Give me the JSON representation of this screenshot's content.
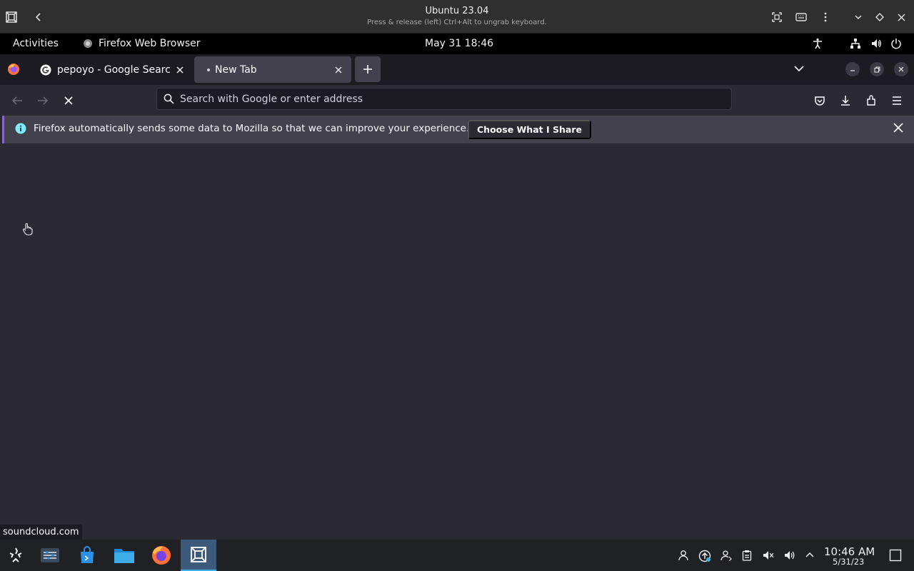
{
  "vm": {
    "title": "Ubuntu 23.04",
    "subtitle": "Press & release (left) Ctrl+Alt to ungrab keyboard."
  },
  "gnome": {
    "activities": "Activities",
    "app_name": "Firefox Web Browser",
    "clock": "May 31  18:46"
  },
  "tabs": [
    {
      "label": "pepoyo - Google Search",
      "icon": "google-g-icon",
      "active": false
    },
    {
      "label": "New Tab",
      "icon": "dot-icon",
      "active": true
    }
  ],
  "urlbar": {
    "placeholder": "Search with Google or enter address",
    "value": ""
  },
  "notification": {
    "text": "Firefox automatically sends some data to Mozilla so that we can improve your experience.",
    "button": "Choose What I Share"
  },
  "status_url": "soundcloud.com",
  "host": {
    "time": "10:46 AM",
    "date": "5/31/23"
  },
  "colors": {
    "accent": "#9059ff",
    "content_bg": "#2b2a33",
    "tab_strip": "#1c1b22",
    "selected_tab": "#42414d"
  }
}
